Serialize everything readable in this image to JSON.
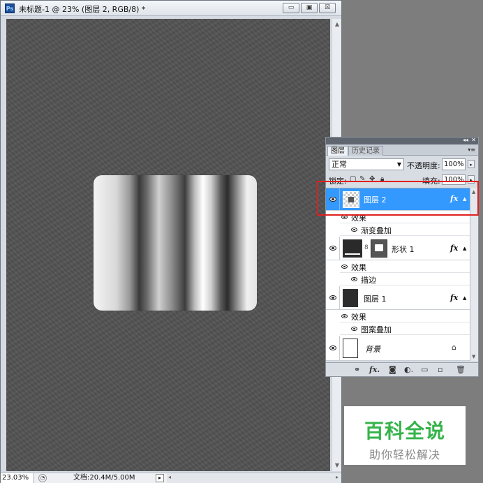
{
  "app": {
    "icon_label": "Ps"
  },
  "document": {
    "title": "未标题-1 @ 23% (图层 2, RGB/8) *",
    "window_buttons": [
      "▭",
      "▣",
      "☒"
    ]
  },
  "status": {
    "zoom": "23.03%",
    "doc_size": "文档:20.4M/5.00M",
    "menu_arrow": "▸"
  },
  "panel": {
    "tabs": [
      "图层",
      "历史记录"
    ],
    "blend_mode": "正常",
    "opacity_label": "不透明度:",
    "opacity_value": "100%",
    "lock_label": "锁定:",
    "fill_label": "填充:",
    "fill_value": "100%",
    "fx_label": "fx",
    "layers": [
      {
        "name": "图层 2",
        "selected": true,
        "effects_label": "效果",
        "effects": [
          "渐变叠加"
        ]
      },
      {
        "name": "形状 1",
        "selected": false,
        "effects_label": "效果",
        "effects": [
          "描边"
        ]
      },
      {
        "name": "图层 1",
        "selected": false,
        "effects_label": "效果",
        "effects": [
          "图案叠加"
        ]
      },
      {
        "name": "背景",
        "selected": false,
        "locked": true
      }
    ]
  },
  "watermark": {
    "title": "百科全说",
    "subtitle": "助你轻松解决"
  },
  "colors": {
    "selection": "#3399ff",
    "highlight": "#e02020",
    "watermark_green": "#35b34a"
  }
}
